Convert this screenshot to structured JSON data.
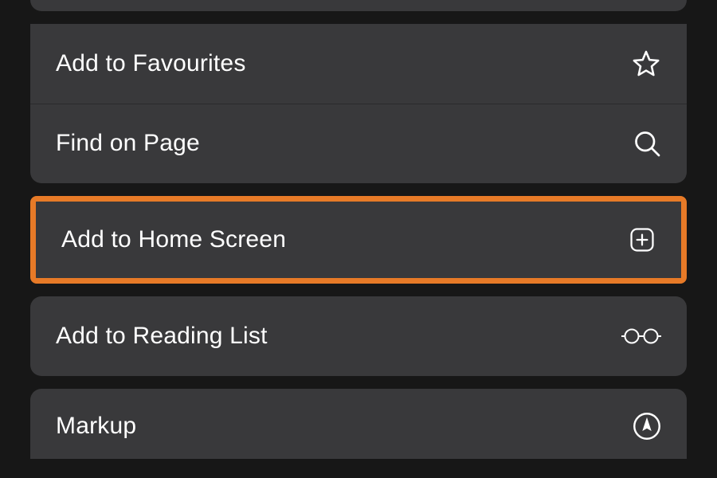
{
  "menu": {
    "items": [
      {
        "label": "Add to Favourites",
        "icon": "star"
      },
      {
        "label": "Find on Page",
        "icon": "search"
      },
      {
        "label": "Add to Home Screen",
        "icon": "plus-square",
        "highlighted": true
      },
      {
        "label": "Add to Reading List",
        "icon": "glasses"
      },
      {
        "label": "Markup",
        "icon": "markup"
      }
    ]
  },
  "highlight_color": "#e77a27"
}
